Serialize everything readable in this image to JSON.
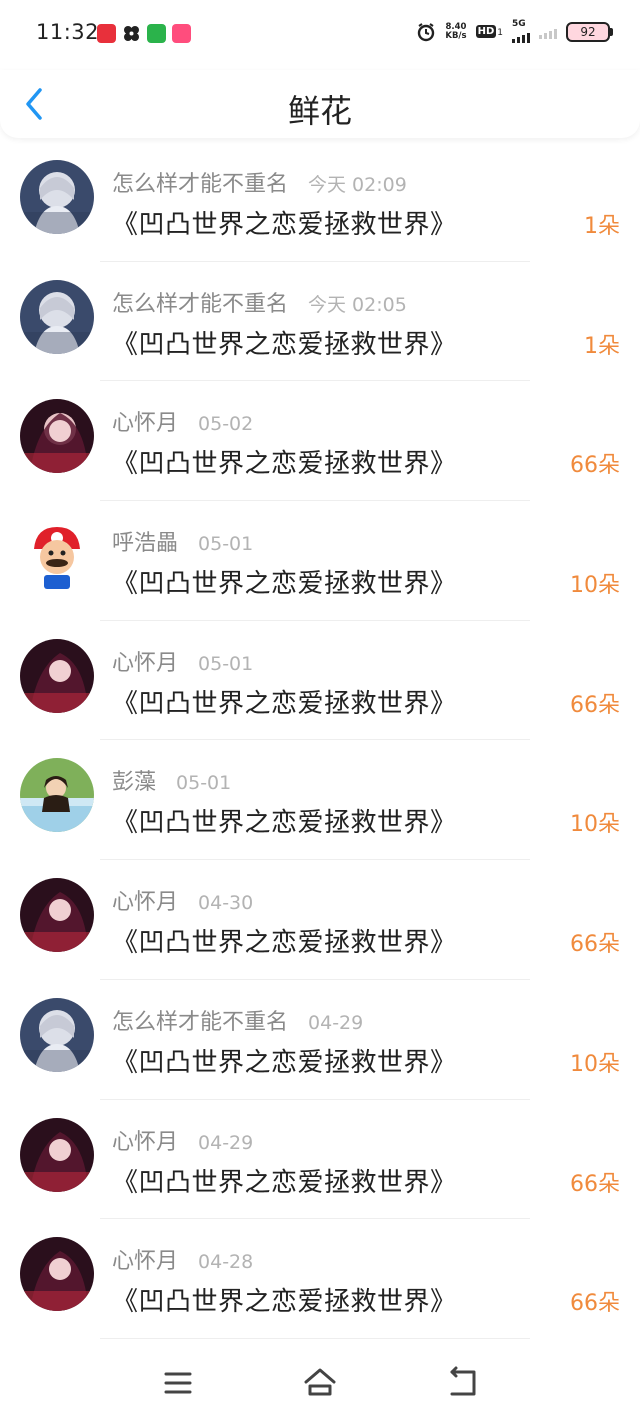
{
  "status_bar": {
    "time": "11:32",
    "net_speed_value": "8.40",
    "net_speed_unit": "KB/s",
    "hd_label": "HD",
    "hd_sub": "1",
    "network_label": "5G",
    "battery": "92",
    "app_icons": [
      "app-icon-red",
      "app-icon-pinwheel",
      "app-icon-video",
      "app-icon-pink"
    ]
  },
  "header": {
    "title": "鲜花",
    "back_icon": "chevron-left-icon",
    "accent_color": "#2196f3"
  },
  "colors": {
    "count": "#f08a3c",
    "username": "#8a8a8a",
    "time": "#b3b3b3"
  },
  "records": [
    {
      "user": "怎么样才能不重名",
      "time": "今天 02:09",
      "title": "《凹凸世界之恋爱拯救世界》",
      "count": "1朵",
      "avatar": "avatar-white-hair"
    },
    {
      "user": "怎么样才能不重名",
      "time": "今天 02:05",
      "title": "《凹凸世界之恋爱拯救世界》",
      "count": "1朵",
      "avatar": "avatar-white-hair"
    },
    {
      "user": "心怀月",
      "time": "05-02",
      "title": "《凹凸世界之恋爱拯救世界》",
      "count": "66朵",
      "avatar": "avatar-dark-red"
    },
    {
      "user": "呼浩畾",
      "time": "05-01",
      "title": "《凹凸世界之恋爱拯救世界》",
      "count": "10朵",
      "avatar": "avatar-mario"
    },
    {
      "user": "心怀月",
      "time": "05-01",
      "title": "《凹凸世界之恋爱拯救世界》",
      "count": "66朵",
      "avatar": "avatar-dark-red"
    },
    {
      "user": "彭藻",
      "time": "05-01",
      "title": "《凹凸世界之恋爱拯救世界》",
      "count": "10朵",
      "avatar": "avatar-girl-grass"
    },
    {
      "user": "心怀月",
      "time": "04-30",
      "title": "《凹凸世界之恋爱拯救世界》",
      "count": "66朵",
      "avatar": "avatar-dark-red"
    },
    {
      "user": "怎么样才能不重名",
      "time": "04-29",
      "title": "《凹凸世界之恋爱拯救世界》",
      "count": "10朵",
      "avatar": "avatar-white-hair"
    },
    {
      "user": "心怀月",
      "time": "04-29",
      "title": "《凹凸世界之恋爱拯救世界》",
      "count": "66朵",
      "avatar": "avatar-dark-red"
    },
    {
      "user": "心怀月",
      "time": "04-28",
      "title": "《凹凸世界之恋爱拯救世界》",
      "count": "66朵",
      "avatar": "avatar-dark-red"
    }
  ],
  "nav": {
    "menu_icon": "menu-icon",
    "home_icon": "home-icon",
    "back_icon": "return-icon"
  }
}
